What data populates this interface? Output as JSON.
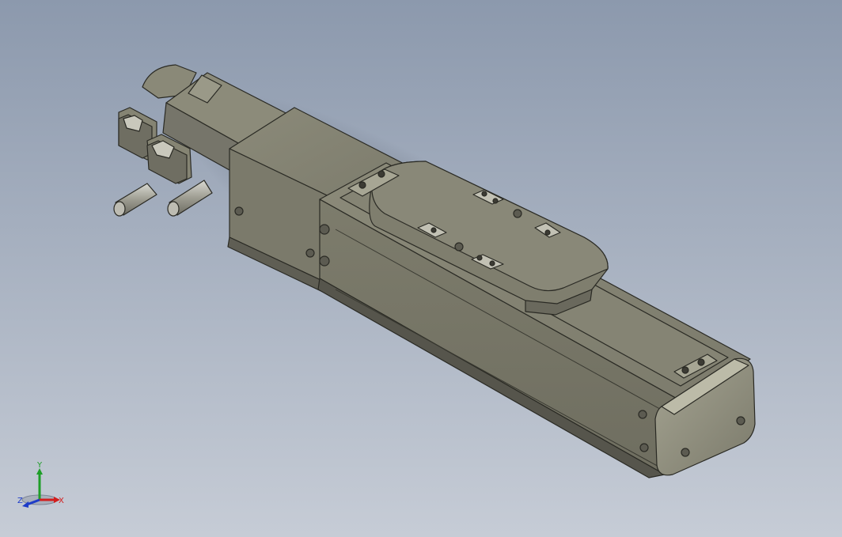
{
  "viewport": {
    "background_top": "#8c99ad",
    "background_bottom": "#c6ccd6",
    "model_color": "#7f7e6e"
  },
  "triad": {
    "x_label": "X",
    "y_label": "Y",
    "z_label": "Z",
    "x_color": "#d21e1e",
    "y_color": "#1e9e28",
    "z_color": "#1e3cc8"
  }
}
